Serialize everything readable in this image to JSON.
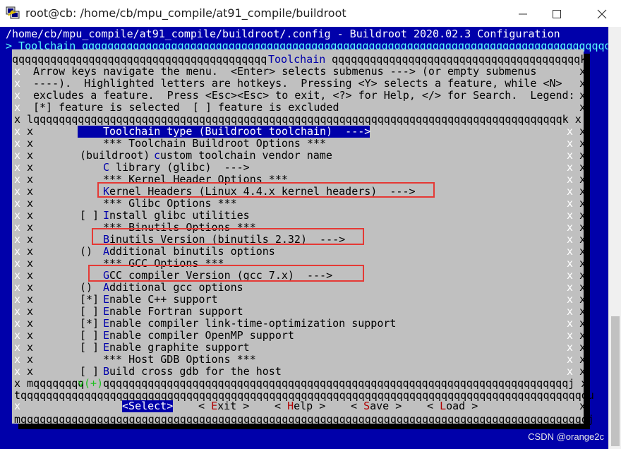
{
  "window": {
    "title": "root@cb: /home/cb/mpu_compile/at91_compile/buildroot"
  },
  "terminal": {
    "header": "/home/cb/mpu_compile/at91_compile/buildroot/.config - Buildroot 2020.02.3 Configuration",
    "breadcrumb": "> Toolchain",
    "breadcrumb_fill": "qqqqqqqqqqqqqqqqqqqqqqqqqqqqqqqqqqqqqqqqqqqqqqqqqqqqqqqqqqqqqqqqqqqqqqqqqqqqqqqqqqqq",
    "dialog_title": "Toolchain",
    "help_lines": [
      "Arrow keys navigate the menu.  <Enter> selects submenus ---> (or empty submenus",
      "----).  Highlighted letters are hotkeys.  Pressing <Y> selects a feature, while <N>",
      "excludes a feature.  Press <Esc><Esc> to exit, <?> for Help, </> for Search.  Legend:",
      "[*] feature is selected  [ ] feature is excluded"
    ],
    "menu_items": [
      {
        "prefix": "",
        "hotkey": "T",
        "rest": "oolchain type (Buildroot toolchain)  --->",
        "selected": true
      },
      {
        "prefix": "",
        "hotkey": "",
        "rest": "*** Toolchain Buildroot Options ***",
        "selected": false
      },
      {
        "prefix": "(buildroot) ",
        "hotkey": "c",
        "rest": "ustom toolchain vendor name",
        "selected": false
      },
      {
        "prefix": "",
        "hotkey": "C",
        "rest": " library (glibc)  --->",
        "selected": false
      },
      {
        "prefix": "",
        "hotkey": "",
        "rest": "*** Kernel Header Options ***",
        "selected": false
      },
      {
        "prefix": "",
        "hotkey": "K",
        "rest": "ernel Headers (Linux 4.4.x kernel headers)  --->",
        "selected": false
      },
      {
        "prefix": "",
        "hotkey": "",
        "rest": "*** Glibc Options ***",
        "selected": false
      },
      {
        "prefix": "[ ] ",
        "hotkey": "I",
        "rest": "nstall glibc utilities",
        "selected": false
      },
      {
        "prefix": "",
        "hotkey": "",
        "rest": "*** Binutils Options ***",
        "selected": false
      },
      {
        "prefix": "",
        "hotkey": "B",
        "rest": "inutils Version (binutils 2.32)  --->",
        "selected": false
      },
      {
        "prefix": "()  ",
        "hotkey": "A",
        "rest": "dditional binutils options",
        "selected": false
      },
      {
        "prefix": "",
        "hotkey": "",
        "rest": "*** GCC Options ***",
        "selected": false
      },
      {
        "prefix": "",
        "hotkey": "G",
        "rest": "CC compiler Version (gcc 7.x)  --->",
        "selected": false
      },
      {
        "prefix": "()  ",
        "hotkey": "A",
        "rest": "dditional gcc options",
        "selected": false
      },
      {
        "prefix": "[*] ",
        "hotkey": "E",
        "rest": "nable C++ support",
        "selected": false
      },
      {
        "prefix": "[ ] ",
        "hotkey": "E",
        "rest": "nable Fortran support",
        "selected": false
      },
      {
        "prefix": "[*] ",
        "hotkey": "E",
        "rest": "nable compiler link-time-optimization support",
        "selected": false
      },
      {
        "prefix": "[ ] ",
        "hotkey": "E",
        "rest": "nable compiler OpenMP support",
        "selected": false
      },
      {
        "prefix": "[ ] ",
        "hotkey": "E",
        "rest": "nable graphite support",
        "selected": false
      },
      {
        "prefix": "",
        "hotkey": "",
        "rest": "*** Host GDB Options ***",
        "selected": false
      },
      {
        "prefix": "[ ] ",
        "hotkey": "B",
        "rest": "uild cross gdb for the host",
        "selected": false
      }
    ],
    "more_indicator": "v(+)",
    "buttons": [
      {
        "pre": "<",
        "hotkey": "S",
        "rest": "elect>",
        "active": true
      },
      {
        "pre": "< ",
        "hotkey": "E",
        "rest": "xit >",
        "active": false
      },
      {
        "pre": "< ",
        "hotkey": "H",
        "rest": "elp >",
        "active": false
      },
      {
        "pre": "< ",
        "hotkey": "S",
        "rest": "ave >",
        "active": false
      },
      {
        "pre": "< ",
        "hotkey": "L",
        "rest": "oad >",
        "active": false
      }
    ]
  },
  "watermark": "CSDN @orange2c",
  "colors": {
    "terminal_bg": "#0000aa",
    "dialog_bg": "#c0c0c0",
    "header_fg": "#58ffff",
    "highlight_box": "#e53935"
  }
}
